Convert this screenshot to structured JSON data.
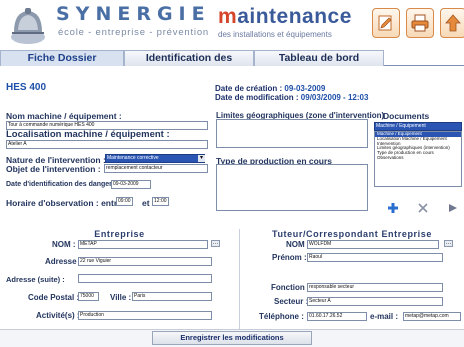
{
  "header": {
    "brand": "SYNERGIE",
    "tagline": "école - entreprise - prévention",
    "title_lead": "m",
    "title_rest": "aintenance",
    "subtitle": "des installations et équipements"
  },
  "tabs": [
    {
      "label": "Fiche Dossier",
      "active": true
    },
    {
      "label": "Identification des dangers",
      "active": false
    },
    {
      "label": "Tableau de bord",
      "active": false
    }
  ],
  "record": {
    "ref": "HES 400",
    "creation_label": "Date de création :",
    "creation_value": "09-03-2009",
    "modification_label": "Date de modification :",
    "modification_value": "09/03/2009 - 12:03"
  },
  "form": {
    "machine_label": "Nom machine / équipement :",
    "machine_value": "Tour à commande numérique HES 400",
    "location_label": "Localisation machine / équipement :",
    "location_value": "Atelier A",
    "intervention_type_label": "Nature de l'intervention :",
    "intervention_type_value": "Maintenance corrective",
    "intervention_object_label": "Objet de l'intervention :",
    "intervention_object_value": "remplacement contacteur",
    "danger_date_label": "Date d'identification des dangers :",
    "danger_date_value": "09-03-2009",
    "hours_label": "Horaire d'observation : entre",
    "hours_from": "09:00",
    "hours_and": "et",
    "hours_to": "12:00",
    "limits_label": "Limites géographiques (zone d'intervention)",
    "production_label": "Type de production en cours"
  },
  "documents": {
    "title": "Documents associés",
    "selected": "Machine / Equipement",
    "items": [
      "Machine / Equipement",
      "Localisation Machine / Equipement",
      "Intervention",
      "Limites géographiques (intervention)",
      "Type de production en cours",
      "Observations"
    ]
  },
  "enterprise": {
    "title": "Entreprise",
    "name_label": "NOM :",
    "name_value": "METAP",
    "address_label": "Adresse :",
    "address_value": "22 rue Viguier",
    "address2_label": "Adresse (suite) :",
    "address2_value": "",
    "postal_label": "Code Postal :",
    "postal_value": "75000",
    "city_label": "Ville :",
    "city_value": "Paris",
    "activity_label": "Activité(s) :",
    "activity_value": "Production"
  },
  "tutor": {
    "title": "Tuteur/Correspondant  Entreprise",
    "name_label": "NOM :",
    "name_value": "WOLFDM",
    "firstname_label": "Prénom :",
    "firstname_value": "Raoul",
    "function_label": "Fonction :",
    "function_value": "responsable secteur",
    "sector_label": "Secteur :",
    "sector_value": "Secteur A",
    "phone_label": "Téléphone :",
    "phone_value": "01.60.17.26.52",
    "email_label": "e-mail :",
    "email_value": "metap@metap.com"
  },
  "footer": {
    "save_label": "Enregistrer les modifications"
  },
  "colors": {
    "brand_blue": "#4a6fa5",
    "accent_red": "#d4452a",
    "tab_active": "#d8e1ef",
    "selection": "#2a55b3"
  }
}
